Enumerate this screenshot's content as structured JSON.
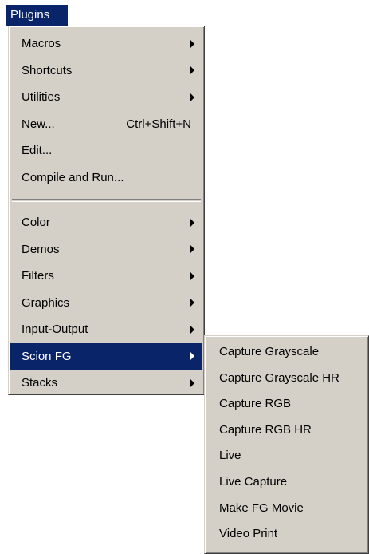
{
  "menubar": {
    "title": "Plugins"
  },
  "main_menu": {
    "group1": [
      {
        "label": "Macros",
        "submenu": true
      },
      {
        "label": "Shortcuts",
        "submenu": true
      },
      {
        "label": "Utilities",
        "submenu": true
      },
      {
        "label": "New...",
        "shortcut": "Ctrl+Shift+N"
      },
      {
        "label": "Edit..."
      },
      {
        "label": "Compile and Run..."
      }
    ],
    "group2": [
      {
        "label": "Color",
        "submenu": true
      },
      {
        "label": "Demos",
        "submenu": true
      },
      {
        "label": "Filters",
        "submenu": true
      },
      {
        "label": "Graphics",
        "submenu": true
      },
      {
        "label": "Input-Output",
        "submenu": true
      },
      {
        "label": "Scion FG",
        "submenu": true,
        "highlighted": true
      },
      {
        "label": "Stacks",
        "submenu": true
      }
    ]
  },
  "scion_submenu": {
    "items": [
      {
        "label": "Capture Grayscale"
      },
      {
        "label": "Capture Grayscale HR"
      },
      {
        "label": "Capture RGB"
      },
      {
        "label": "Capture RGB HR"
      },
      {
        "label": "Live"
      },
      {
        "label": "Live Capture"
      },
      {
        "label": "Make FG Movie"
      },
      {
        "label": "Video Print"
      }
    ]
  },
  "colors": {
    "menu_bg": "#d4d0c8",
    "highlight": "#0a246a",
    "highlight_text": "#ffffff"
  }
}
